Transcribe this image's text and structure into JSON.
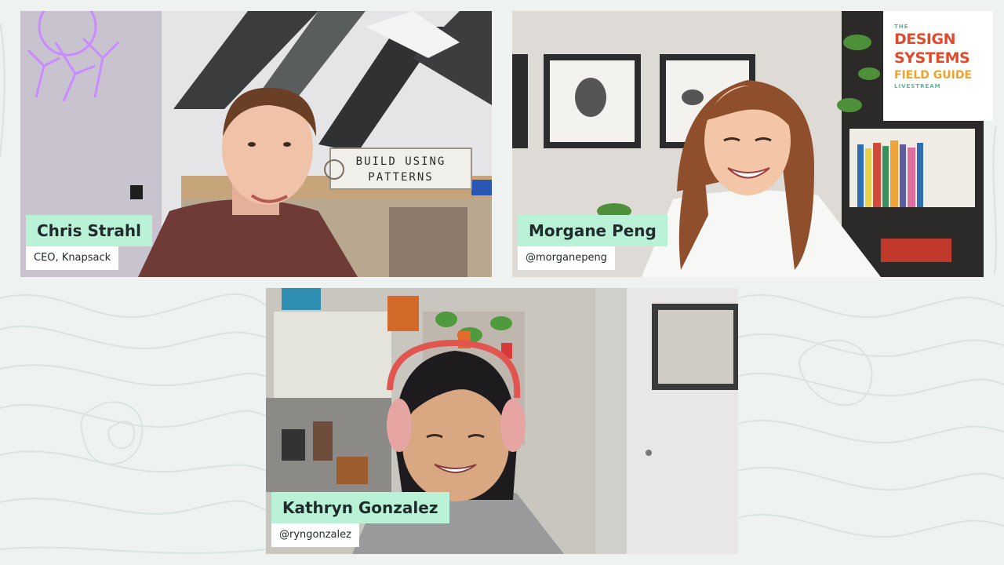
{
  "participants": [
    {
      "name": "Chris Strahl",
      "subtitle": "CEO, Knapsack"
    },
    {
      "name": "Morgane Peng",
      "subtitle": "@morganepeng"
    },
    {
      "name": "Kathryn Gonzalez",
      "subtitle": "@ryngonzalez"
    }
  ],
  "background_sign": {
    "line1": "BUILD USING",
    "line2": "PATTERNS"
  },
  "logo": {
    "top_small": "THE",
    "line1": "DESIGN",
    "line2": "SYSTEMS",
    "line3": "FIELD GUIDE",
    "bottom_small": "LIVESTREAM"
  },
  "colors": {
    "nameplate": "#b9f2d6",
    "background": "#eef3f2",
    "logo_red": "#e24a2c",
    "logo_orange": "#f2a227"
  }
}
